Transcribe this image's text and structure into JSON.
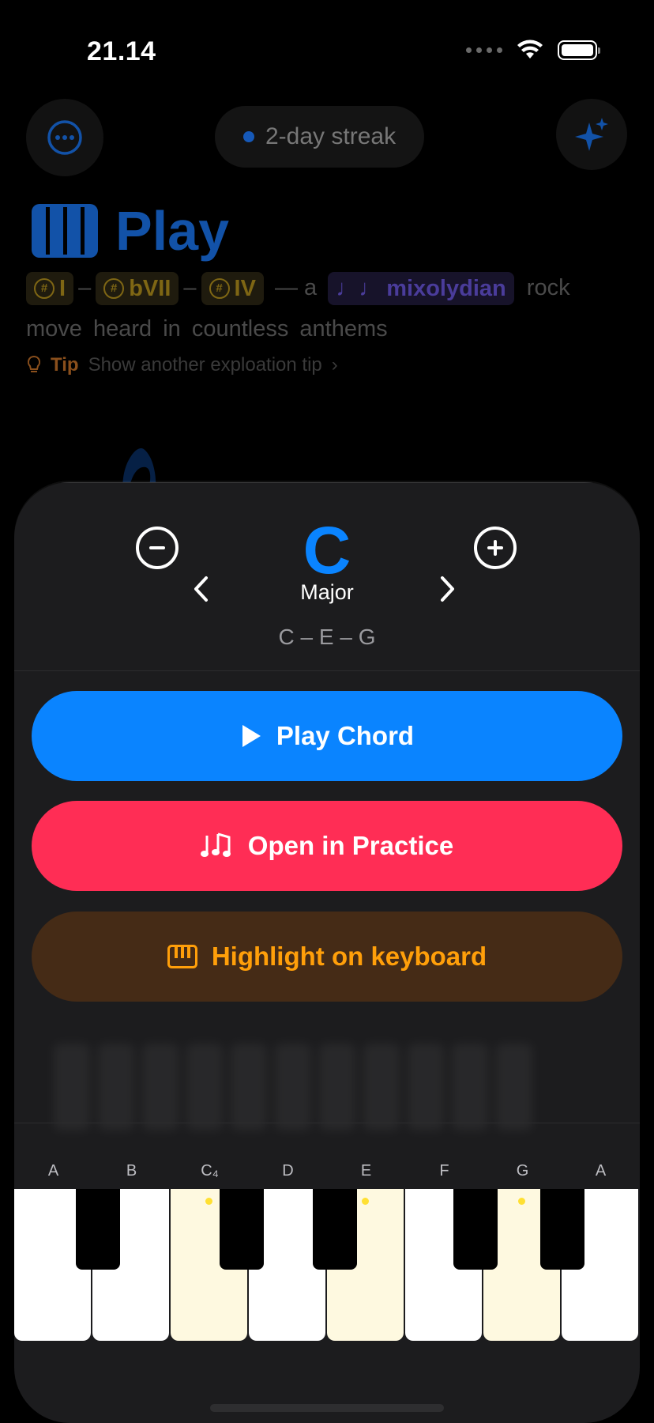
{
  "status_bar": {
    "time": "21.14"
  },
  "background": {
    "streak_label": "2-day streak",
    "title": "Play",
    "progression": {
      "chords": [
        "I",
        "bVII",
        "IV"
      ],
      "chord_glyph": "#",
      "connector": "— a",
      "mode": "mixolydian",
      "description": "rock move heard in countless anthems"
    },
    "tip": {
      "label": "Tip",
      "text": "Show another exploation tip"
    }
  },
  "sheet": {
    "root": "C",
    "quality": "Major",
    "notes": "C – E – G",
    "play_label": "Play Chord",
    "practice_label": "Open in Practice",
    "highlight_label": "Highlight on keyboard",
    "key_labels": [
      "A",
      "B",
      "C₄",
      "D",
      "E",
      "F",
      "G",
      "A"
    ],
    "highlighted_keys": [
      "C",
      "E",
      "G"
    ]
  },
  "colors": {
    "accent_blue": "#0a84ff",
    "practice_pink": "#ff2d55",
    "highlight_orange": "#ff9f0a",
    "highlight_bg": "#452b16",
    "lit_key": "#fef9e0"
  },
  "icons": {
    "more": "ellipsis-circle-icon",
    "ai": "sparkles-icon",
    "piano": "piano-keys-icon",
    "tip": "lightbulb-icon",
    "minus": "minus-circle-icon",
    "plus": "plus-circle-icon",
    "play": "play-icon",
    "notes": "music-notes-icon"
  }
}
